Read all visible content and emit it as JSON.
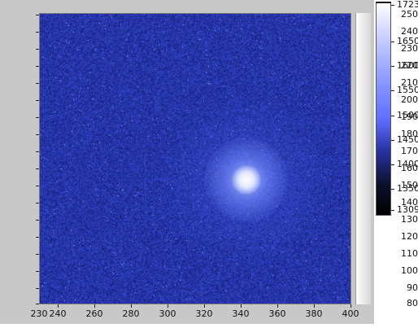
{
  "plot": {
    "x_axis": {
      "ticks": [
        "230",
        "240",
        "260",
        "280",
        "300",
        "320",
        "340",
        "360",
        "380",
        "400"
      ]
    },
    "y_axis": {
      "ticks": [
        "250",
        "240",
        "230",
        "220",
        "210",
        "200",
        "190",
        "180",
        "170",
        "160",
        "150",
        "140",
        "130",
        "120",
        "110",
        "100",
        "90",
        "80"
      ]
    }
  },
  "colorbar": {
    "labels": [
      "1723",
      "1650",
      "1600",
      "1550",
      "1500",
      "1450",
      "1400",
      "1350",
      "1309"
    ],
    "colors": {
      "top": "#ffffff",
      "mid": "#5f6dff",
      "bottom": "#000000"
    }
  },
  "colors": {
    "plot_background": "#1f2f8f",
    "frame": "#c8c8c8",
    "hotspot_center": "#ffffff"
  }
}
